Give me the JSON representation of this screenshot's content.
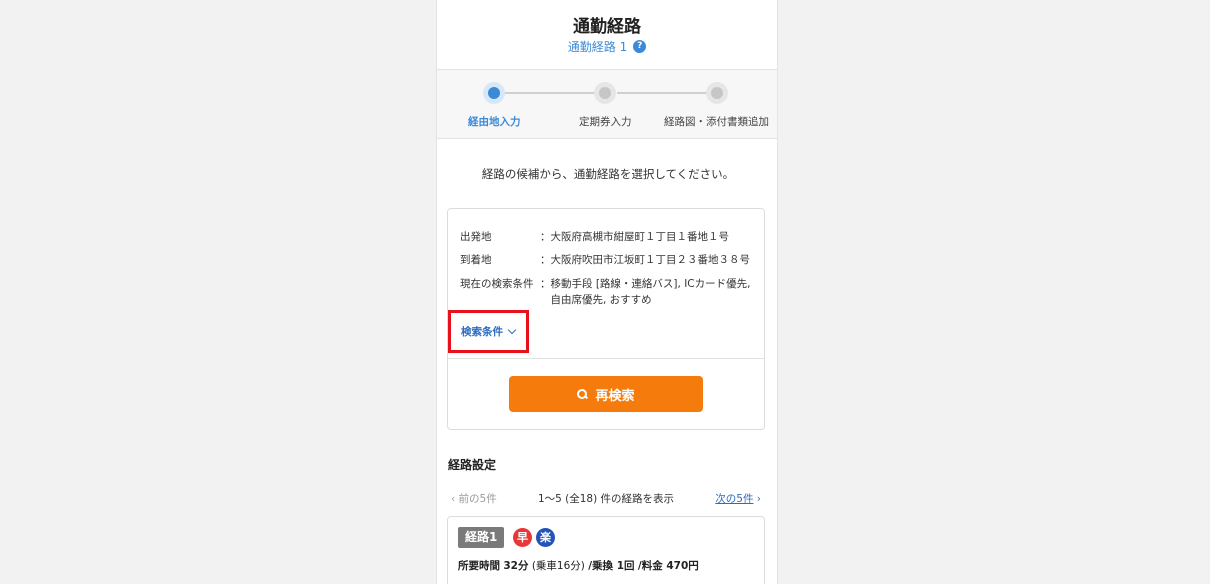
{
  "header": {
    "title": "通勤経路",
    "subtitle": "通勤経路 1",
    "help_icon": "?"
  },
  "steps": [
    {
      "label": "経由地入力",
      "active": true
    },
    {
      "label": "定期券入力",
      "active": false
    },
    {
      "label": "経路図・添付書類追加",
      "active": false
    }
  ],
  "instruction": "経路の候補から、通勤経路を選択してください。",
  "conditions": {
    "departure_label": "出発地",
    "departure_value": "：大阪府高槻市紺屋町１丁目１番地１号",
    "arrival_label": "到着地",
    "arrival_value": "：大阪府吹田市江坂町１丁目２３番地３８号",
    "search_label": "現在の検索条件",
    "search_value_prefix": "：",
    "search_value": "移動手段 [路線・連絡バス], ICカード優先, 自由席優先, おすすめ",
    "toggle_label": "検索条件"
  },
  "research_button": "再検索",
  "section_title": "経路設定",
  "pager": {
    "prev": "前の5件",
    "info": "1〜5 (全18) 件の経路を表示",
    "next": "次の5件",
    "prev_glyph": "‹",
    "next_glyph": "›"
  },
  "route": {
    "badge": "経路1",
    "tag_fast": "早",
    "tag_easy": "楽",
    "time_label": "所要時間",
    "time_value": "32分",
    "ride_detail": "(乗車16分)",
    "transfer": "/乗換 1回",
    "fare": "/料金 470円"
  },
  "colors": {
    "accent": "#3b8ad8",
    "button": "#f67b0d",
    "highlight": "#e8101b"
  }
}
